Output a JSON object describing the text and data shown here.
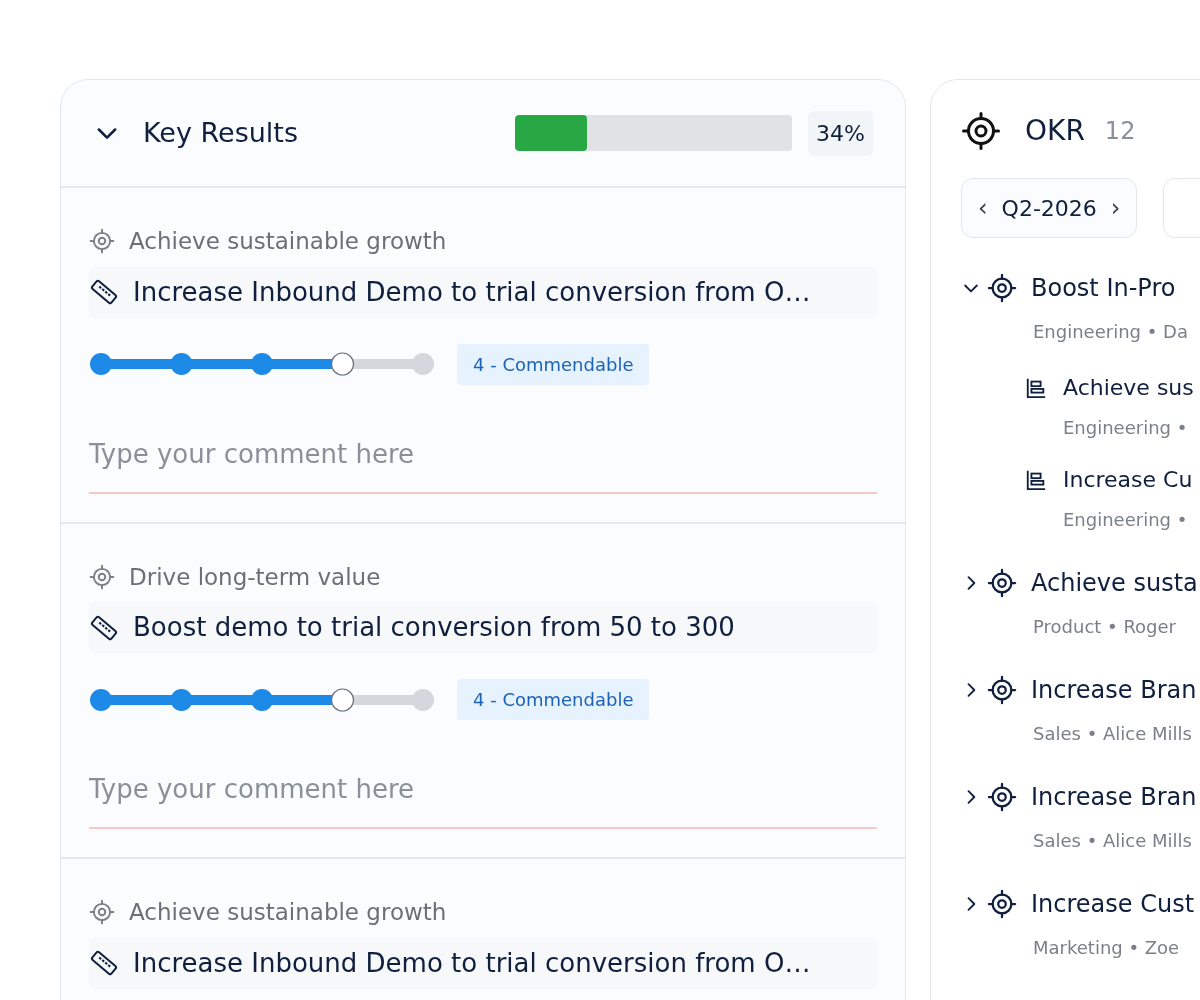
{
  "key_results": {
    "title": "Key Results",
    "expanded": true,
    "level": 0.26,
    "percent": "34%",
    "items": [
      {
        "objective": "Achieve sustainable growth",
        "title": "Increase Inbound Demo to trial conversion from O…",
        "level": 0.75,
        "rating": "4 - Commendable",
        "placeholder": "Type your comment here"
      },
      {
        "objective": "Drive long-term value",
        "title": "Boost demo to trial conversion from 50 to 300",
        "level": 0.75,
        "rating": "4 - Commendable",
        "placeholder": "Type your comment here"
      },
      {
        "objective": "Achieve sustainable growth",
        "title": "Increase Inbound Demo to trial conversion from O…"
      }
    ]
  },
  "okr": {
    "title": "OKR",
    "count": "12",
    "quarter": "Q2-2026",
    "prev": "‹",
    "next": "›",
    "tree": [
      {
        "title": "Boost In-Pro",
        "meta": "Engineering • Da",
        "expanded": true,
        "children": [
          {
            "title": "Achieve sus",
            "meta": "Engineering •"
          },
          {
            "title": "Increase Cu",
            "meta": "Engineering •"
          }
        ]
      },
      {
        "title": "Achieve susta",
        "meta": "Product • Roger",
        "expanded": false
      },
      {
        "title": "Increase Bran",
        "meta": "Sales • Alice Mills",
        "expanded": false
      },
      {
        "title": "Increase Bran",
        "meta": "Sales • Alice Mills",
        "expanded": false
      },
      {
        "title": "Increase Cust",
        "meta": "Marketing • Zoe",
        "expanded": false
      }
    ]
  }
}
